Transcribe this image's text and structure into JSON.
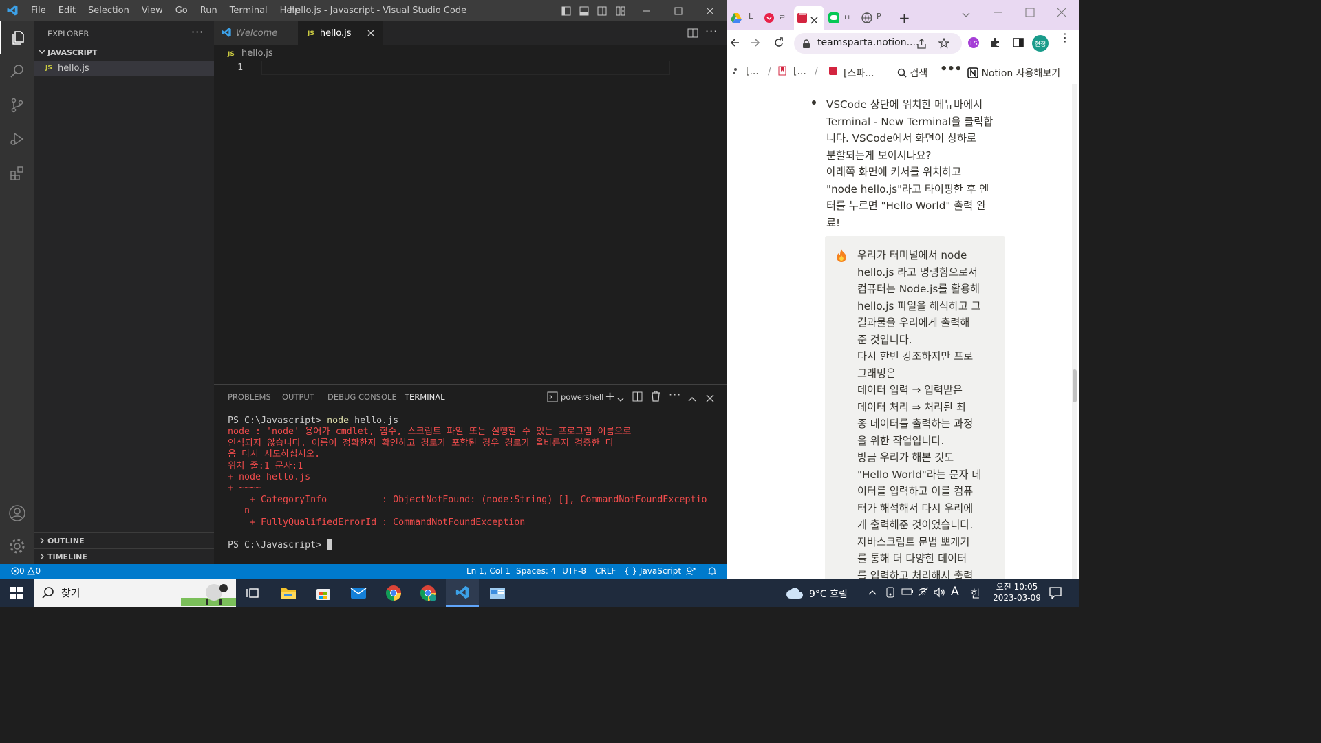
{
  "vscode": {
    "menu": [
      "File",
      "Edit",
      "Selection",
      "View",
      "Go",
      "Run",
      "Terminal",
      "Help"
    ],
    "window_title": "hello.js - Javascript - Visual Studio Code",
    "explorer": {
      "title": "EXPLORER",
      "folder": "JAVASCRIPT",
      "file": "hello.js",
      "outline": "OUTLINE",
      "timeline": "TIMELINE"
    },
    "tabs": [
      {
        "label": "Welcome"
      },
      {
        "label": "hello.js"
      }
    ],
    "breadcrumb": "hello.js",
    "line_number": "1",
    "js_badge": "JS",
    "panel_tabs": [
      "PROBLEMS",
      "OUTPUT",
      "DEBUG CONSOLE",
      "TERMINAL"
    ],
    "terminal_shell": "powershell",
    "terminal": {
      "prompt1": "PS C:\\Javascript> ",
      "cmd": "node",
      "arg": " hello.js",
      "err1": "node : 'node' 용어가 cmdlet, 함수, 스크립트 파일 또는 실행할 수 있는 프로그램 이름으로",
      "err2": "인식되지 않습니다. 이름이 정확한지 확인하고 경로가 포함된 경우 경로가 올바른지 검증한 다",
      "err3": "음 다시 시도하십시오.",
      "err4": "위치 줄:1 문자:1",
      "err5": "+ node hello.js",
      "err6": "+ ~~~~",
      "err7": "    + CategoryInfo          : ObjectNotFound: (node:String) [], CommandNotFoundExceptio",
      "err8": "   n",
      "err9": "    + FullyQualifiedErrorId : CommandNotFoundException",
      "prompt2": "PS C:\\Javascript> "
    },
    "status": {
      "errors": "0",
      "warnings": "0",
      "position": "Ln 1, Col 1",
      "spaces": "Spaces: 4",
      "encoding": "UTF-8",
      "eol": "CRLF",
      "language": "JavaScript"
    }
  },
  "chrome": {
    "tabs": [
      "L",
      "",
      "",
      " ",
      "P"
    ],
    "url": "teamsparta.notion....",
    "profile": "현정",
    "breadcrumbs": [
      "[...",
      "[...",
      "[스파..."
    ],
    "search": "검색",
    "notion_try": "Notion 사용해보기",
    "bullet": [
      "VSCode 상단에 위치한 메뉴바에서",
      "Terminal - New Terminal을 클릭합",
      "니다. VSCode에서 화면이 상하로",
      "분할되는게 보이시나요?",
      "아래쪽 화면에 커서를 위치하고",
      "\"node hello.js\"라고 타이핑한 후 엔",
      "터를 누르면 \"Hello World\" 출력 완",
      "료!"
    ],
    "callout": [
      "우리가 터미널에서 node",
      "hello.js 라고 명령함으로서",
      "컴퓨터는 Node.js를 활용해",
      "hello.js 파일을 해석하고 그",
      "결과물을 우리에게 출력해",
      "준 것입니다.",
      "다시 한번 강조하지만 프로",
      "그래밍은",
      "데이터 입력 ⇒ 입력받은",
      "데이터 처리 ⇒ 처리된  최",
      "종 데이터를 출력하는 과정",
      "을 위한 작업입니다.",
      "방금 우리가 해본 것도",
      "\"Hello World\"라는 문자 데",
      "이터를 입력하고 이를 컴퓨",
      "터가 해석해서 다시 우리에",
      "게 출력해준 것이었습니다.",
      "자바스크립트 문법 뽀개기",
      "를 통해 더 다양한 데이터",
      "를 입력하고 처리해서 출력"
    ]
  },
  "taskbar": {
    "search": "찾기",
    "weather": "9°C 흐림",
    "ime": "A",
    "lang": "한",
    "time": "오전 10:05",
    "date": "2023-03-09"
  },
  "colors": {
    "accent": "#007acc",
    "error": "#f14c4c",
    "chrome_tabbar": "#e9d9f2"
  }
}
